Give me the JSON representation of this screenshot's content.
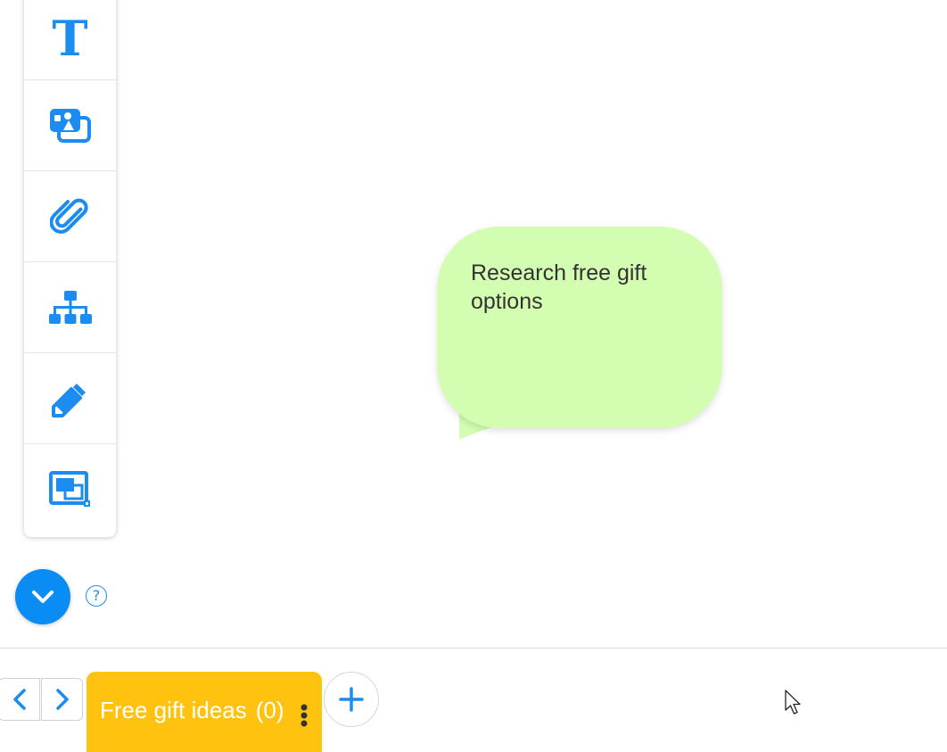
{
  "toolbar": {
    "items": [
      {
        "id": "text",
        "icon": "text-icon",
        "glyph": "T"
      },
      {
        "id": "media",
        "icon": "media-icon"
      },
      {
        "id": "attachment",
        "icon": "paperclip-icon"
      },
      {
        "id": "org-chart",
        "icon": "org-chart-icon"
      },
      {
        "id": "draw",
        "icon": "pencil-icon"
      },
      {
        "id": "frame",
        "icon": "frame-icon"
      }
    ]
  },
  "controls": {
    "collapse_icon": "chevron-down-icon",
    "help_label": "?"
  },
  "canvas": {
    "note_text": "Research free gift options",
    "note_color": "#d3fdb0"
  },
  "bottom_bar": {
    "active_tab": {
      "label": "Free gift ideas",
      "count": "(0)"
    },
    "tab_color": "#ffc20e",
    "accent": "#1d8cf0"
  }
}
